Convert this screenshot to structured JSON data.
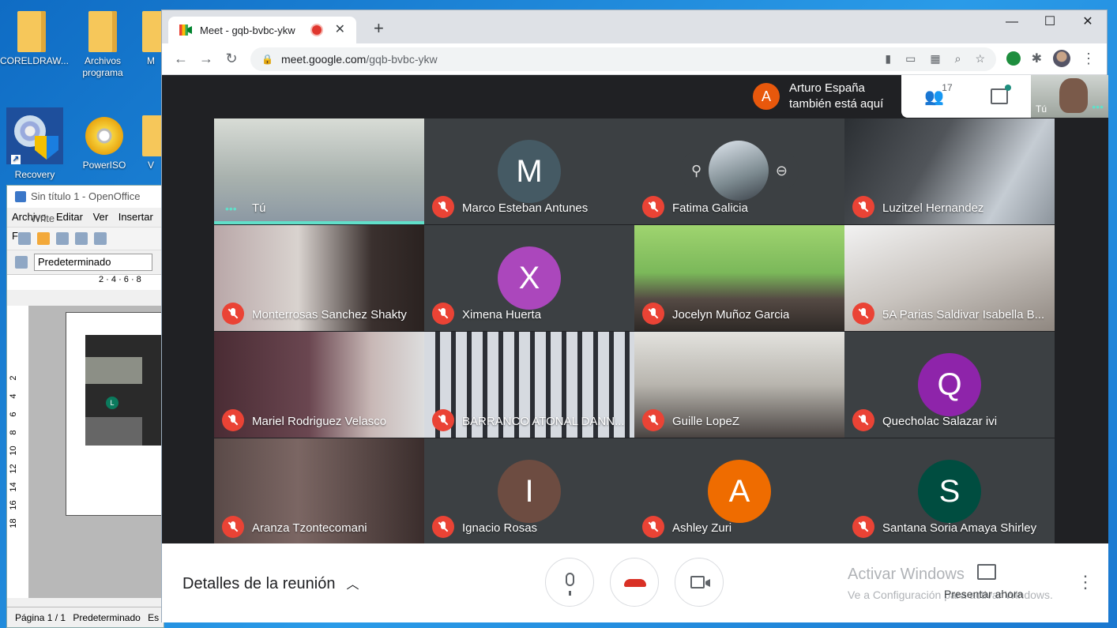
{
  "desktop": {
    "icons": [
      {
        "label": "CORELDRAW..."
      },
      {
        "label": "Archivos programa"
      },
      {
        "label": "M"
      },
      {
        "label": "Recovery"
      },
      {
        "label": "PowerISO"
      },
      {
        "label": "V"
      }
    ]
  },
  "openoffice": {
    "title": "Sin título 1 - OpenOffice Write",
    "menu": [
      "Archivo",
      "Editar",
      "Ver",
      "Insertar",
      "F"
    ],
    "style_value": "Predeterminado",
    "ruler_ticks": "2 · 4 · 6 · 8",
    "vruler": [
      "2",
      "4",
      "6",
      "8",
      "10",
      "12",
      "14",
      "16",
      "18"
    ],
    "status_page": "Página  1 / 1",
    "status_style": "Predeterminado",
    "status_lang": "Es"
  },
  "browser": {
    "tab_title": "Meet - gqb-bvbc-ykw",
    "new_tab": "+",
    "url_domain": "meet.google.com",
    "url_path": "/gqb-bvbc-ykw",
    "window_controls": {
      "minimize": "—",
      "maximize": "☐",
      "close": "✕"
    }
  },
  "meet": {
    "notice": {
      "initial": "A",
      "line1": "Arturo España",
      "line2": "también está aquí"
    },
    "participant_count": "17",
    "self_label": "Tú",
    "tiles": [
      {
        "name": "Tú",
        "type": "video",
        "self": true
      },
      {
        "name": "Marco Esteban Antunes",
        "type": "avatar",
        "initial": "M",
        "color": "#455a64"
      },
      {
        "name": "Fatima Galicia",
        "type": "pinned"
      },
      {
        "name": "Luzitzel Hernandez",
        "type": "video"
      },
      {
        "name": "Monterrosas Sanchez Shakty",
        "type": "video"
      },
      {
        "name": "Ximena Huerta",
        "type": "avatar",
        "initial": "X",
        "color": "#ab47bc"
      },
      {
        "name": "Jocelyn Muñoz Garcia",
        "type": "video"
      },
      {
        "name": "5A Parias Saldivar Isabella B...",
        "type": "video"
      },
      {
        "name": "Mariel Rodriguez Velasco",
        "type": "video"
      },
      {
        "name": "BARRANCO ATONAL DANN...",
        "type": "video"
      },
      {
        "name": "Guille LopeZ",
        "type": "video"
      },
      {
        "name": "Quecholac Salazar ivi",
        "type": "avatar",
        "initial": "Q",
        "color": "#8e24aa"
      },
      {
        "name": "Aranza Tzontecomani",
        "type": "video"
      },
      {
        "name": "Ignacio Rosas",
        "type": "avatar",
        "initial": "I",
        "color": "#6d4c41"
      },
      {
        "name": "Ashley Zuri",
        "type": "avatar",
        "initial": "A",
        "color": "#ef6c00"
      },
      {
        "name": "Santana Soria Amaya Shirley",
        "type": "avatar",
        "initial": "S",
        "color": "#004d40"
      }
    ],
    "bottom": {
      "details_label": "Detalles de la reunión",
      "present_label": "Presentar ahora",
      "activate_title": "Activar Windows",
      "activate_sub": "Ve a Configuración para activar Windows."
    }
  }
}
